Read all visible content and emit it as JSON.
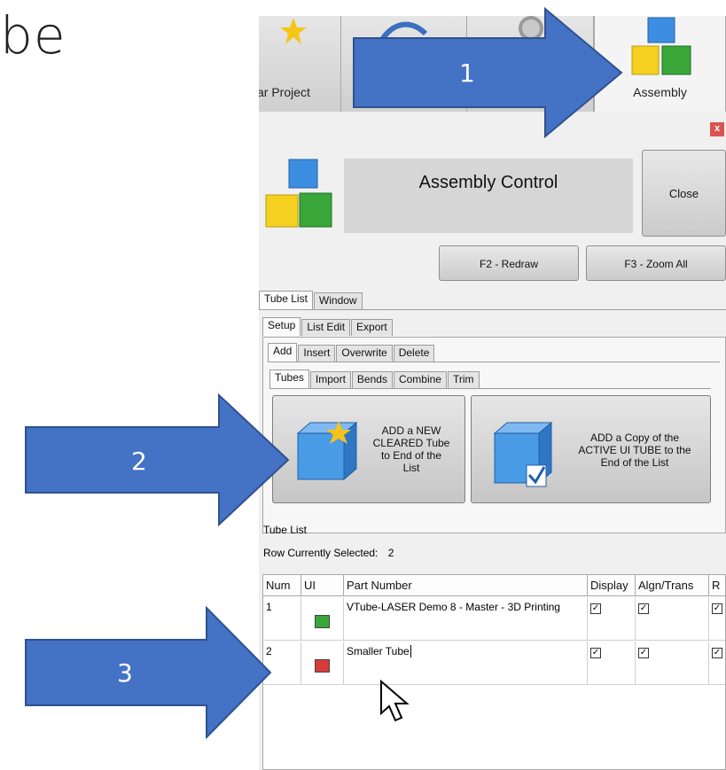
{
  "heading_fragment": "be",
  "ribbon": {
    "tabs": [
      {
        "label": "ar Project"
      },
      {
        "label": ""
      },
      {
        "label": ""
      },
      {
        "label": "Assembly"
      }
    ]
  },
  "panel": {
    "close_x": "x",
    "title": "Assembly Control",
    "close_label": "Close",
    "redraw_label": "F2 - Redraw",
    "zoom_label": "F3 - Zoom All"
  },
  "outer_tabs": [
    "Tube List",
    "Window"
  ],
  "mid_tabs": [
    "Setup",
    "List Edit",
    "Export"
  ],
  "action_tabs": [
    "Add",
    "Insert",
    "Overwrite",
    "Delete"
  ],
  "add_tabs": [
    "Tubes",
    "Import",
    "Bends",
    "Combine",
    "Trim"
  ],
  "add_new_label": [
    "ADD a NEW",
    "CLEARED Tube",
    "to End of the",
    "List"
  ],
  "add_copy_label": [
    "ADD a Copy of the",
    "ACTIVE UI TUBE to the",
    "End of the List"
  ],
  "tube_list": {
    "label": "Tube List",
    "row_selected_label": "Row Currently Selected:",
    "row_selected_value": "2",
    "columns": [
      "Num",
      "UI",
      "Part Number",
      "Display",
      "Algn/Trans",
      "R"
    ],
    "rows": [
      {
        "num": "1",
        "color": "#3aa63a",
        "part": "VTube-LASER Demo 8 - Master - 3D Printing"
      },
      {
        "num": "2",
        "color": "#d93a3a",
        "part": "Smaller Tube"
      }
    ]
  },
  "arrows": [
    "1",
    "2",
    "3"
  ],
  "colors": {
    "arrow_fill": "#4472c4",
    "arrow_stroke": "#2f528f"
  }
}
